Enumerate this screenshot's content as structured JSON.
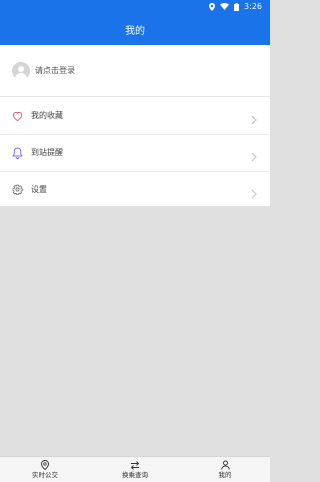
{
  "status_bar": {
    "time": "3:26"
  },
  "app_bar": {
    "title": "我的"
  },
  "login": {
    "label": "请点击登录"
  },
  "menu": [
    {
      "label": "我的收藏",
      "icon": "heart-icon"
    },
    {
      "label": "到站提醒",
      "icon": "bell-icon"
    },
    {
      "label": "设置",
      "icon": "gear-icon"
    }
  ],
  "tabs": [
    {
      "label": "实时公交",
      "icon": "location-pin-icon"
    },
    {
      "label": "换乘查询",
      "icon": "transfer-arrows-icon"
    },
    {
      "label": "我的",
      "icon": "person-icon"
    }
  ],
  "colors": {
    "primary": "#1a73e8",
    "heart": "#e0566a",
    "bell": "#7a6ae8"
  }
}
